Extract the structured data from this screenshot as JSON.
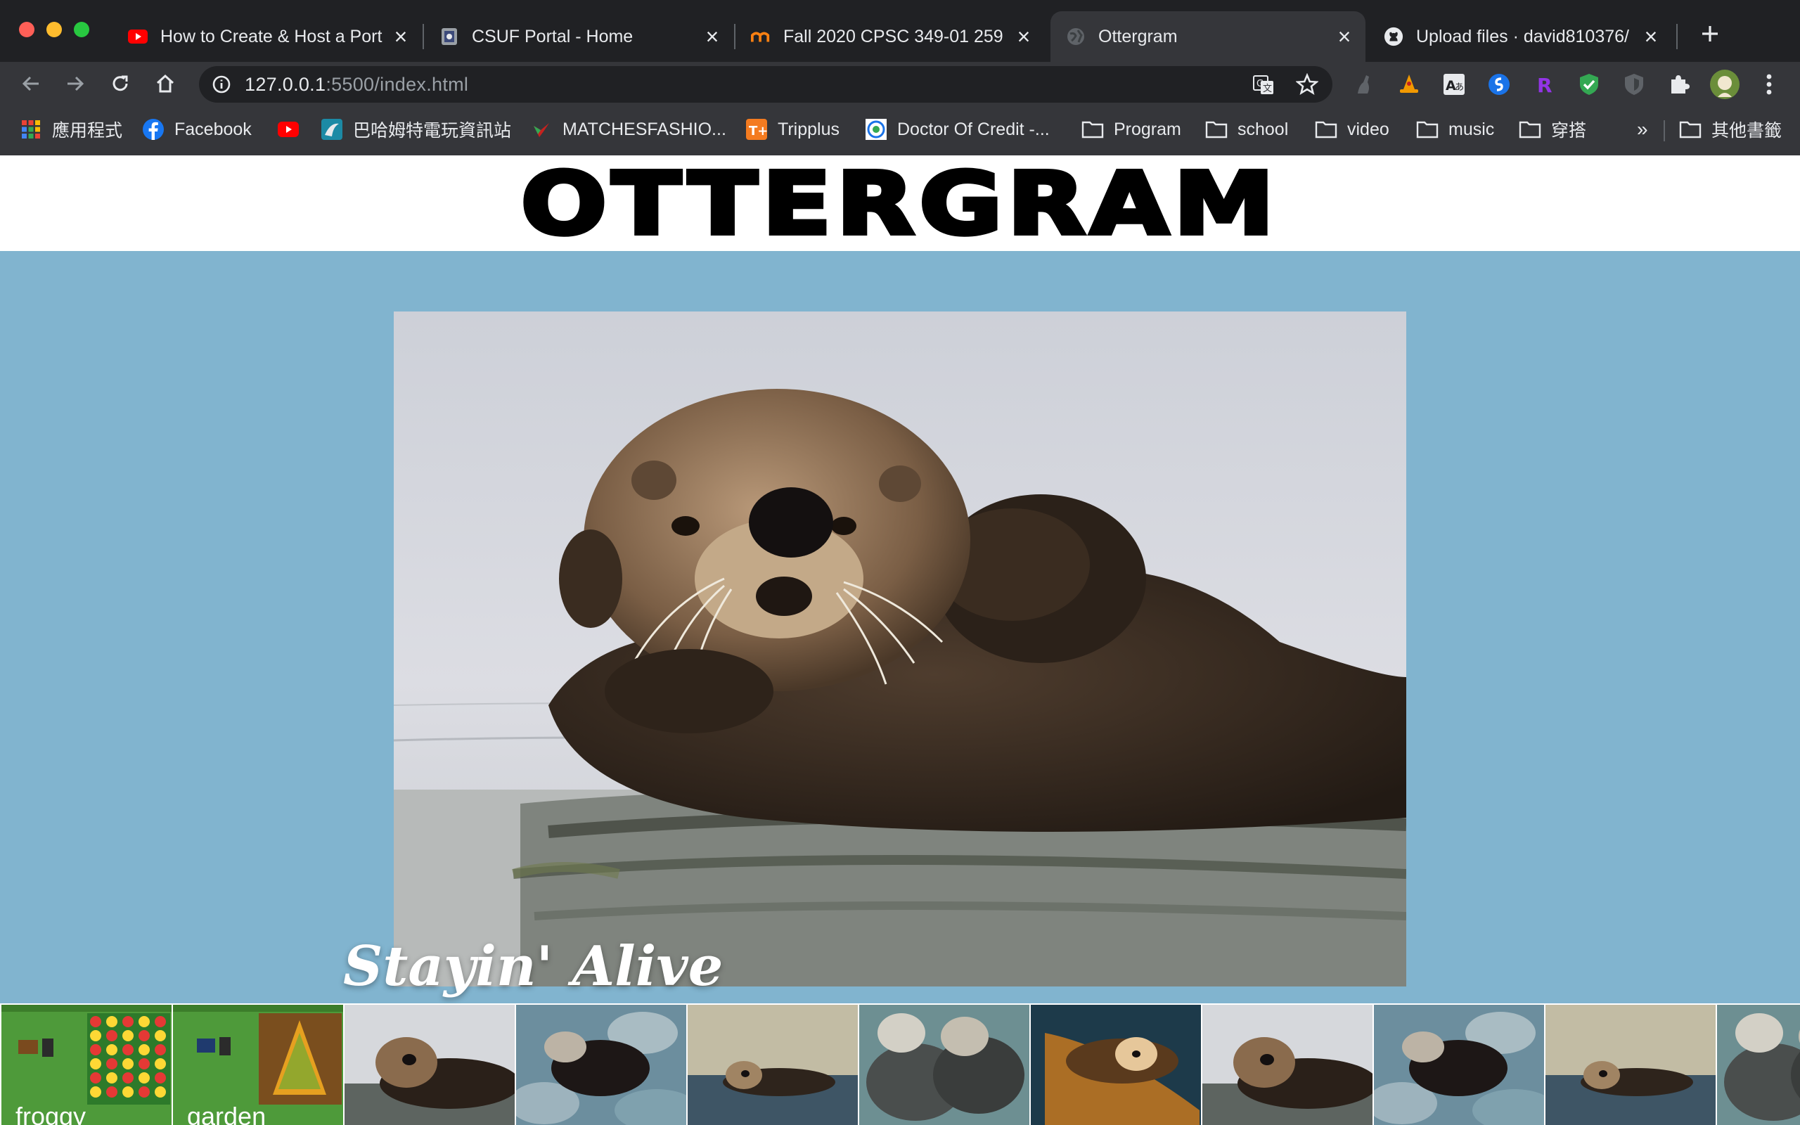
{
  "browser": {
    "tabs": [
      {
        "title": "How to Create & Host a Port",
        "icon": "youtube-icon",
        "active": false
      },
      {
        "title": "CSUF Portal - Home",
        "icon": "csuf-icon",
        "active": false
      },
      {
        "title": "Fall 2020 CPSC 349-01 259",
        "icon": "moodle-icon",
        "active": false
      },
      {
        "title": "Ottergram",
        "icon": "globe-icon",
        "active": true
      },
      {
        "title": "Upload files · david810376/",
        "icon": "github-icon",
        "active": false
      }
    ],
    "url_host": "127.0.0.1",
    "url_path": ":5500/index.html",
    "bookmarks": [
      {
        "label": "應用程式",
        "icon": "apps-grid-icon"
      },
      {
        "label": "Facebook",
        "icon": "facebook-icon"
      },
      {
        "label": "",
        "icon": "youtube-icon"
      },
      {
        "label": "巴哈姆特電玩資訊站",
        "icon": "bahamut-icon"
      },
      {
        "label": "MATCHESFASHIO...",
        "icon": "hummingbird-icon"
      },
      {
        "label": "Tripplus",
        "icon": "tripplus-icon"
      },
      {
        "label": "Doctor Of Credit -...",
        "icon": "doctor-of-credit-icon"
      },
      {
        "label": "Program",
        "icon": "folder-icon"
      },
      {
        "label": "school",
        "icon": "folder-icon"
      },
      {
        "label": "video",
        "icon": "folder-icon"
      },
      {
        "label": "music",
        "icon": "folder-icon"
      },
      {
        "label": "穿搭",
        "icon": "folder-icon"
      }
    ],
    "overflow_label": "»",
    "other_bookmarks": "其他書籤"
  },
  "page": {
    "title": "OTTERGRAM",
    "detail_title": "Stayin' Alive",
    "thumbnails": [
      {
        "label": "froggy",
        "kind": "froggy"
      },
      {
        "label": "garden",
        "kind": "garden"
      },
      {
        "label": "",
        "kind": "otter-floating"
      },
      {
        "label": "",
        "kind": "otter-rocks"
      },
      {
        "label": "",
        "kind": "otter-small"
      },
      {
        "label": "",
        "kind": "otter-pair"
      },
      {
        "label": "",
        "kind": "otter-orange"
      },
      {
        "label": "",
        "kind": "otter-floating"
      },
      {
        "label": "",
        "kind": "otter-rocks"
      },
      {
        "label": "",
        "kind": "otter-small"
      },
      {
        "label": "",
        "kind": "otter-pair"
      }
    ]
  },
  "colors": {
    "page_bg": "#81b4cf",
    "chrome_dark": "#202124",
    "chrome_toolbar": "#35363a"
  }
}
